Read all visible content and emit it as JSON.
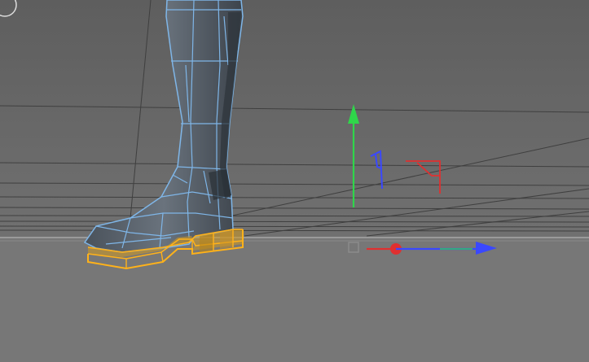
{
  "viewport": {
    "view": "3d-perspective-viewport",
    "selected_object": "boot-mesh",
    "selection_mode": "polygon",
    "colors": {
      "background_top": "#5e5e5e",
      "background_bottom": "#7a7a7a",
      "floor": "#777777",
      "grid_line": "#3f3f3f",
      "horizon": "#9a9a9a",
      "mesh_fill": "#5a636d",
      "mesh_edge": "#7fb6e8",
      "selected_face": "#d19a22",
      "selected_edge": "#ffb21a",
      "axis_x": "#e03030",
      "axis_y": "#2fd64a",
      "axis_z": "#3a48ff"
    }
  },
  "gizmo": {
    "type": "move-tool",
    "axes": [
      "x",
      "y",
      "z"
    ],
    "icons": [
      "axis-arrow-x-icon",
      "axis-arrow-y-icon",
      "axis-arrow-z-icon",
      "plane-handle-xy-icon",
      "plane-handle-zy-icon",
      "center-handle-icon"
    ]
  }
}
